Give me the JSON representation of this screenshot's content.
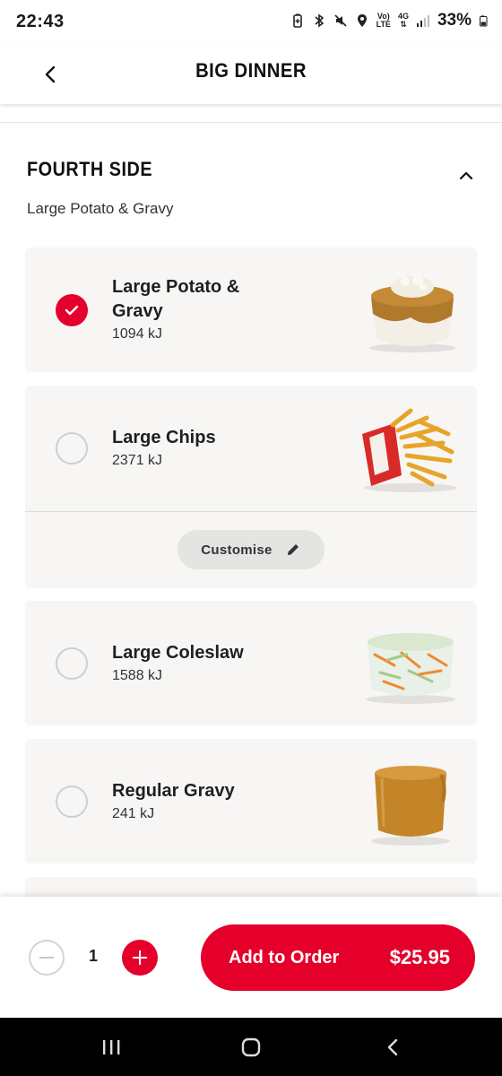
{
  "status_bar": {
    "time": "22:43",
    "network_top": "Vo)",
    "network_bottom": "LTE",
    "network_gen": "4G",
    "battery": "33%",
    "icons": [
      "battery-saver-icon",
      "bluetooth-icon",
      "mute-icon",
      "location-icon",
      "signal-icon",
      "battery-icon"
    ]
  },
  "header": {
    "title": "BIG DINNER",
    "back_icon": "chevron-left-icon"
  },
  "section": {
    "title": "FOURTH SIDE",
    "selected_summary": "Large Potato & Gravy",
    "collapse_icon": "chevron-up-icon"
  },
  "options": [
    {
      "name": "Large Potato & Gravy",
      "energy": "1094 kJ",
      "selected": true,
      "image": "potato-gravy-image"
    },
    {
      "name": "Large Chips",
      "energy": "2371 kJ",
      "selected": false,
      "image": "chips-image",
      "customise_label": "Customise"
    },
    {
      "name": "Large Coleslaw",
      "energy": "1588 kJ",
      "selected": false,
      "image": "coleslaw-image"
    },
    {
      "name": "Regular Gravy",
      "energy": "241 kJ",
      "selected": false,
      "image": "gravy-cup-image"
    }
  ],
  "order_bar": {
    "quantity": "1",
    "add_label": "Add to Order",
    "price": "$25.95"
  },
  "colors": {
    "brand_red": "#e4002b",
    "card_bg": "#f7f6f4"
  }
}
